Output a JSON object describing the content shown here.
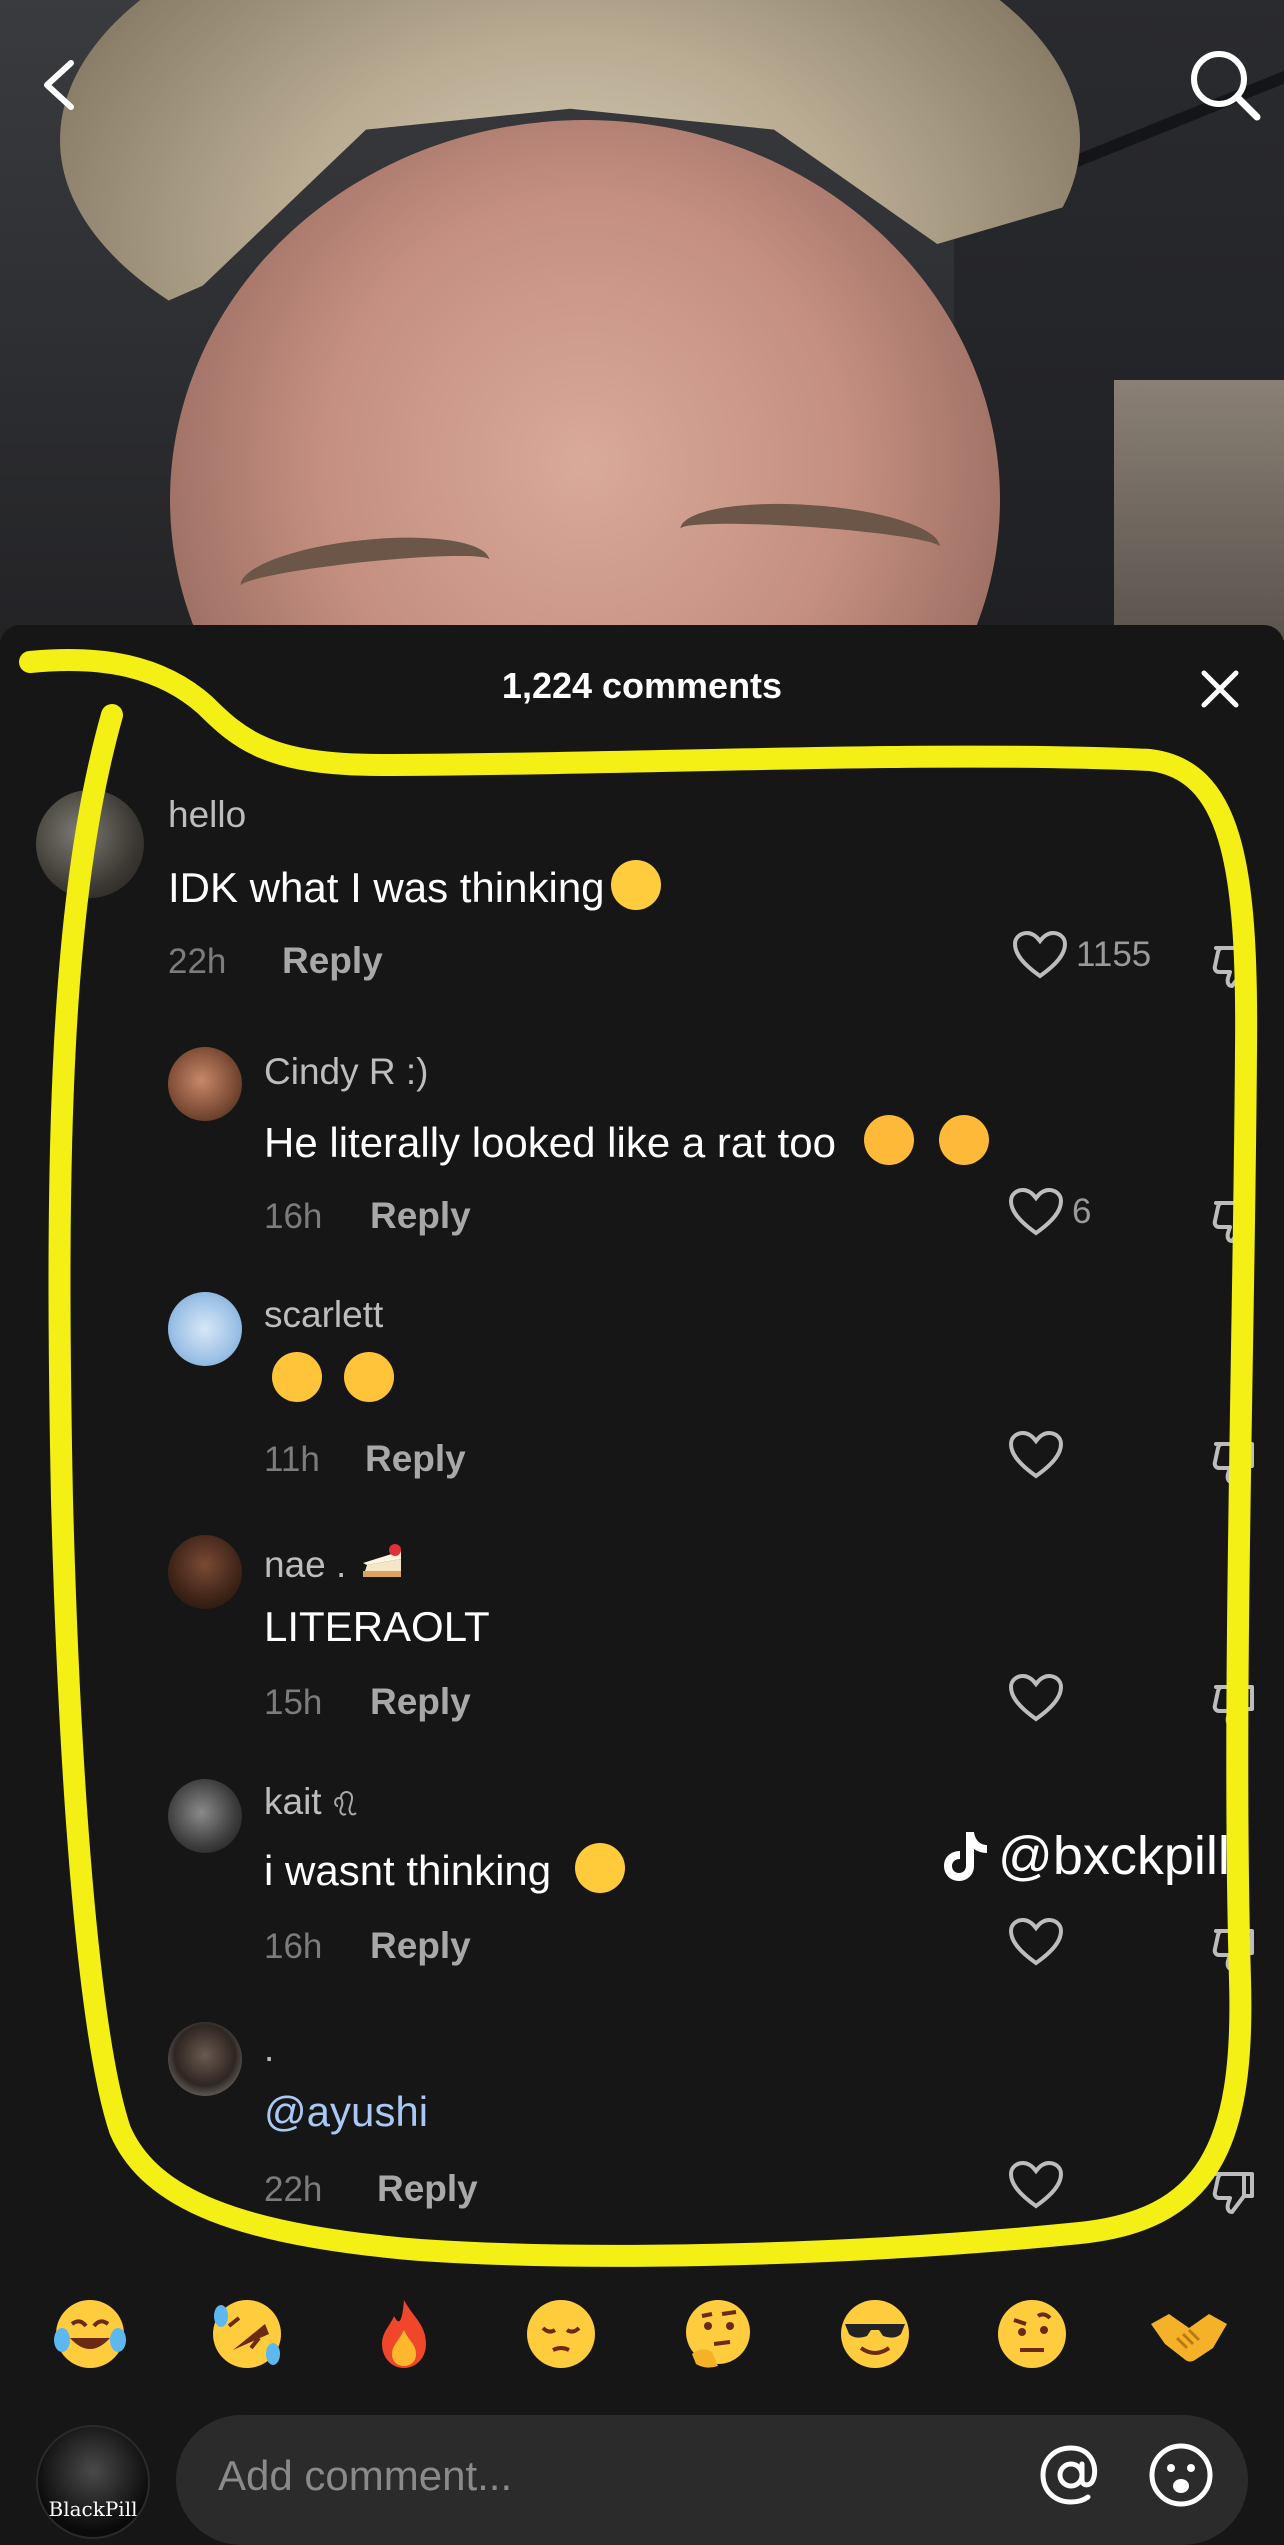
{
  "header": {
    "comment_count_label": "1,224 comments"
  },
  "comments": [
    {
      "user": "hello",
      "text": "IDK what I was thinking",
      "time": "22h",
      "reply_label": "Reply",
      "likes": "1155",
      "emoji": "loudly-crying-face"
    },
    {
      "user": "Cindy R :)",
      "text": "He literally looked like a rat too",
      "time": "16h",
      "reply_label": "Reply",
      "likes": "6",
      "emoji": "weary-face x2"
    },
    {
      "user": "scarlett",
      "text": "",
      "time": "11h",
      "reply_label": "Reply",
      "likes": "",
      "emoji": "squinting-face-with-tongue x2"
    },
    {
      "user": "nae .",
      "text": "LITERAOLT",
      "time": "15h",
      "reply_label": "Reply",
      "likes": "",
      "emoji": "cake"
    },
    {
      "user": "kait",
      "text": "i wasnt thinking",
      "time": "16h",
      "reply_label": "Reply",
      "likes": "",
      "emoji": "frowning-face"
    },
    {
      "user": ".",
      "text": "@ayushi",
      "time": "22h",
      "reply_label": "Reply",
      "likes": ""
    }
  ],
  "watermark": {
    "handle": "@bxckpill"
  },
  "quick_emojis": [
    "face-with-tears-of-joy",
    "rolling-on-the-floor-laughing",
    "fire",
    "pensive-face",
    "thinking-face",
    "smiling-face-with-sunglasses",
    "face-with-raised-eyebrow",
    "handshake"
  ],
  "composer": {
    "placeholder": "Add comment...",
    "avatar_text": "BlackPill"
  },
  "colors": {
    "sheet_bg": "#161617",
    "highlight": "#f4ef15",
    "mention": "#a9c8f4",
    "input_bg": "#2b2b2c"
  }
}
